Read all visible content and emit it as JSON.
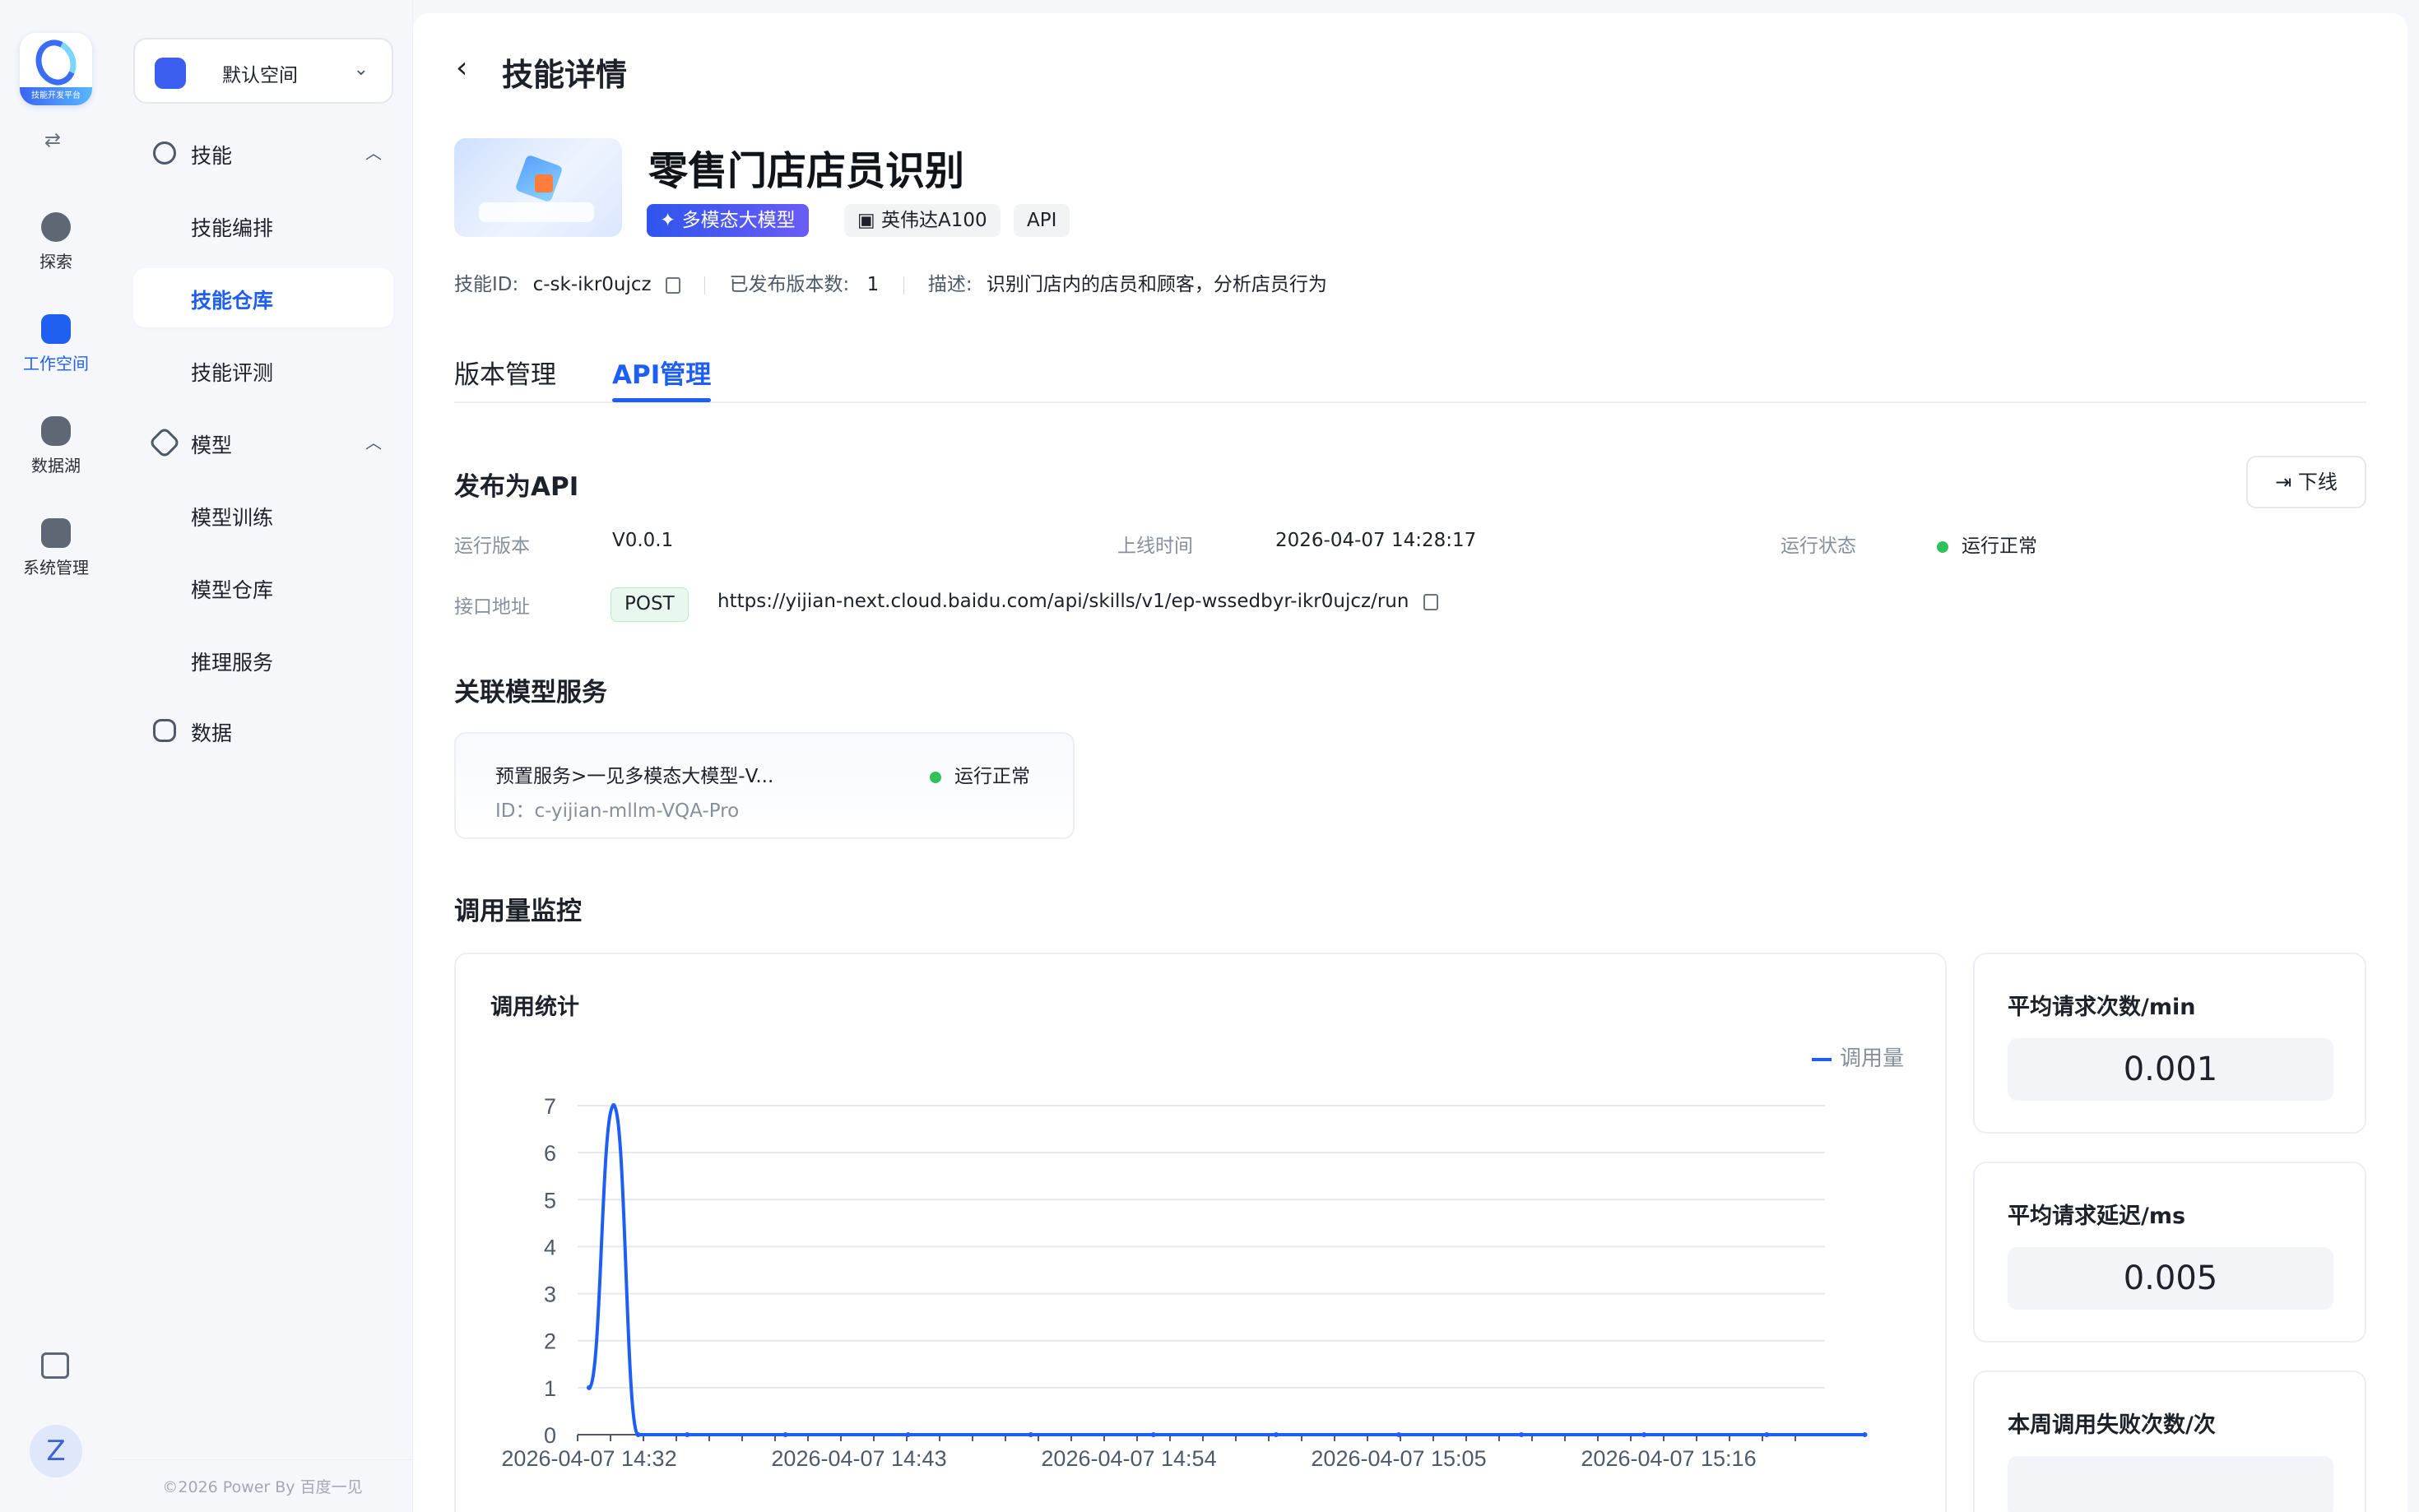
{
  "rail": {
    "logo_caption": "技能开发平台",
    "items": [
      {
        "label": "探索",
        "icon": "planet-icon"
      },
      {
        "label": "工作空间",
        "icon": "folder-terminal-icon"
      },
      {
        "label": "数据湖",
        "icon": "database-icon"
      },
      {
        "label": "系统管理",
        "icon": "settings-sliders-icon"
      }
    ],
    "avatar_letter": "Z"
  },
  "subnav": {
    "space": "默认空间",
    "groups": [
      {
        "label": "技能",
        "items": [
          "技能编排",
          "技能仓库",
          "技能评测"
        ]
      },
      {
        "label": "模型",
        "items": [
          "模型训练",
          "模型仓库",
          "推理服务"
        ]
      },
      {
        "label": "数据",
        "items": []
      }
    ],
    "active_item": "技能仓库",
    "copyright": "©2026 Power By 百度一见"
  },
  "header": {
    "title": "技能详情"
  },
  "skill": {
    "name": "零售门店店员识别",
    "tags": [
      "多模态大模型",
      "英伟达A100",
      "API"
    ],
    "id_label": "技能ID:",
    "id": "c-sk-ikr0ujcz",
    "versions_label": "已发布版本数:",
    "versions": "1",
    "desc_label": "描述:",
    "desc": "识别门店内的店员和顾客，分析店员行为"
  },
  "tabs": [
    "版本管理",
    "API管理"
  ],
  "active_tab": "API管理",
  "publish": {
    "title": "发布为API",
    "offline_button": "下线",
    "run_version_label": "运行版本",
    "run_version": "V0.0.1",
    "online_time_label": "上线时间",
    "online_time": "2026-04-07 14:28:17",
    "run_status_label": "运行状态",
    "run_status": "运行正常",
    "endpoint_label": "接口地址",
    "method": "POST",
    "endpoint": "https://yijian-next.cloud.baidu.com/api/skills/v1/ep-wssedbyr-ikr0ujcz/run"
  },
  "related": {
    "title": "关联模型服务",
    "service_name": "预置服务>一见多模态大模型-V...",
    "service_id": "ID：c-yijian-mllm-VQA-Pro",
    "service_status": "运行正常"
  },
  "monitor": {
    "title": "调用量监控",
    "chart_title": "调用统计",
    "stats": [
      {
        "label": "平均请求次数/min",
        "value": "0.001"
      },
      {
        "label": "平均请求延迟/ms",
        "value": "0.005"
      },
      {
        "label": "本周调用失败次数/次",
        "value": ""
      }
    ]
  },
  "colors": {
    "accent": "#1f5ef5",
    "status_ok": "#2fc25b"
  },
  "chart_data": {
    "type": "line",
    "title": "调用统计",
    "series": [
      {
        "name": "调用量",
        "color": "#1f5ef5",
        "points": [
          [
            "2026-04-07 14:32",
            1
          ],
          [
            "2026-04-07 14:33",
            7
          ],
          [
            "2026-04-07 14:34",
            0
          ],
          [
            "2026-04-07 14:36",
            0
          ],
          [
            "2026-04-07 14:40",
            0
          ],
          [
            "2026-04-07 14:45",
            0
          ],
          [
            "2026-04-07 14:50",
            0
          ],
          [
            "2026-04-07 14:55",
            0
          ],
          [
            "2026-04-07 15:00",
            0
          ],
          [
            "2026-04-07 15:05",
            0
          ],
          [
            "2026-04-07 15:10",
            0
          ],
          [
            "2026-04-07 15:15",
            0
          ],
          [
            "2026-04-07 15:20",
            0
          ],
          [
            "2026-04-07 15:24",
            0
          ]
        ]
      }
    ],
    "x_ticks": [
      "2026-04-07 14:32",
      "2026-04-07 14:43",
      "2026-04-07 14:54",
      "2026-04-07 15:05",
      "2026-04-07 15:16"
    ],
    "y_ticks": [
      0,
      1,
      2,
      3,
      4,
      5,
      6,
      7
    ],
    "ylim": [
      0,
      7
    ],
    "grid": true,
    "legend": "top-right"
  }
}
